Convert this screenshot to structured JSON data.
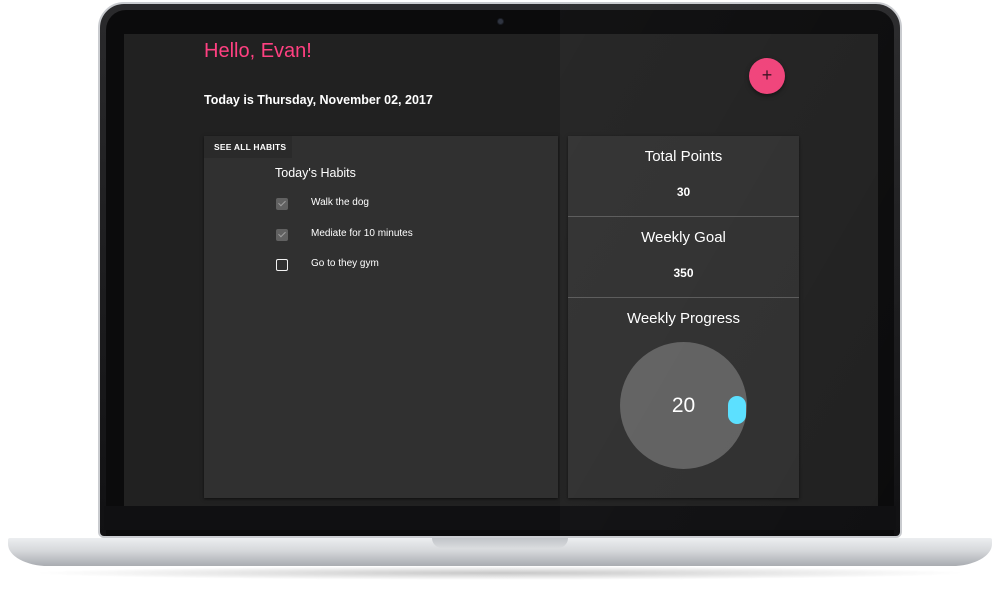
{
  "greeting": "Hello, Evan!",
  "date_line": "Today is Thursday, November 02, 2017",
  "fab": {
    "label": "+",
    "icon": "plus-icon",
    "color": "#ff4081"
  },
  "habits": {
    "see_all_label": "SEE ALL HABITS",
    "title": "Today's Habits",
    "items": [
      {
        "label": "Walk the dog",
        "checked": true
      },
      {
        "label": "Mediate for 10 minutes",
        "checked": true
      },
      {
        "label": "Go to they gym",
        "checked": false
      }
    ]
  },
  "stats": {
    "total_points": {
      "title": "Total Points",
      "value": "30"
    },
    "weekly_goal": {
      "title": "Weekly Goal",
      "value": "350"
    },
    "weekly_progress": {
      "title": "Weekly Progress",
      "value": "20"
    }
  },
  "colors": {
    "accent": "#ff4081",
    "background": "#212121",
    "card": "#303030",
    "progress_knob": "#5ae0ff"
  }
}
